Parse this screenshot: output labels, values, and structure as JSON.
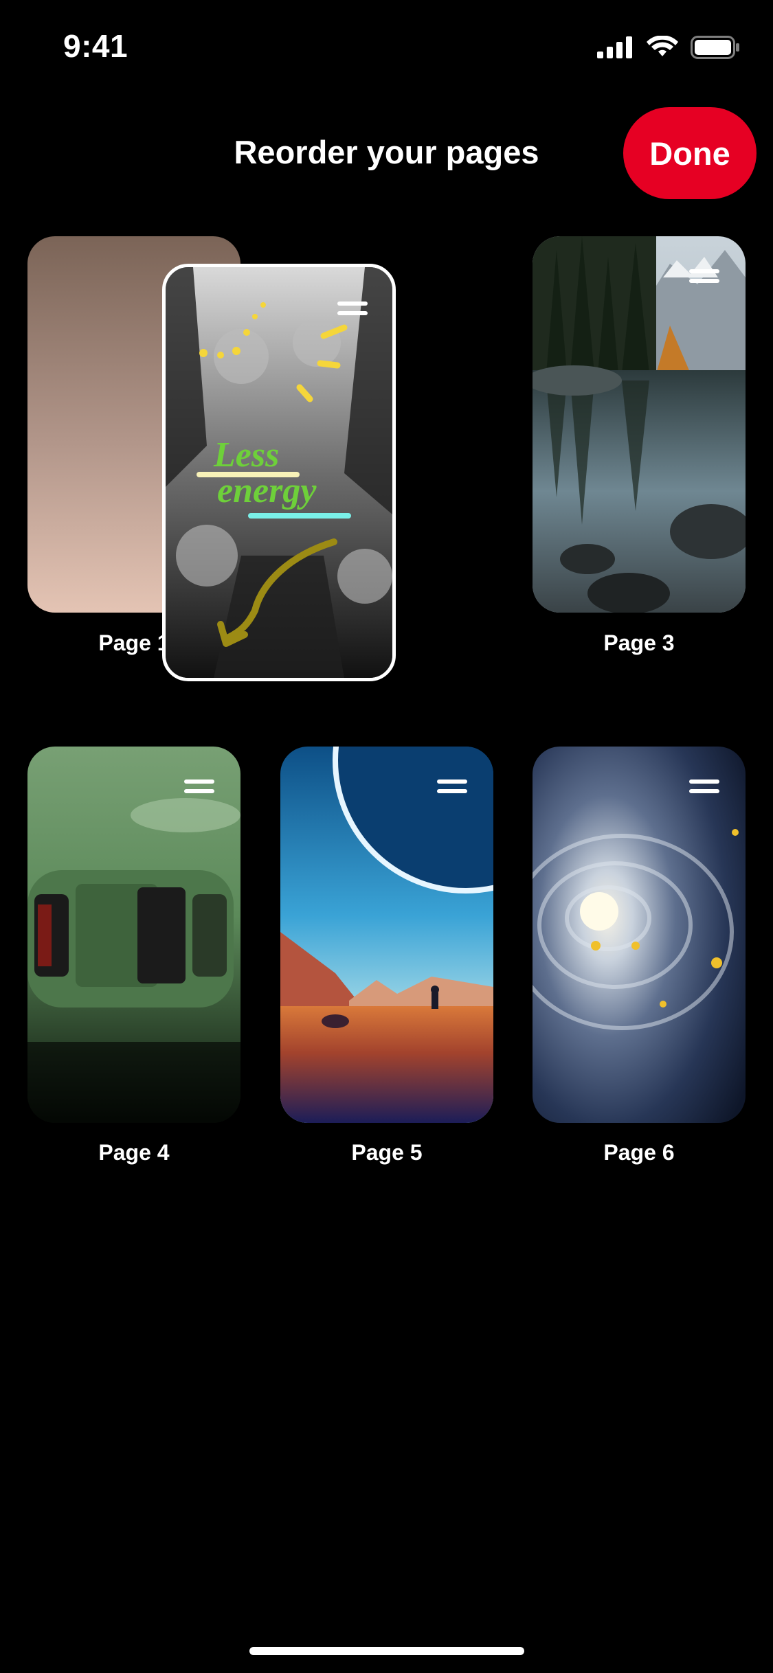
{
  "status_bar": {
    "time": "9:41"
  },
  "header": {
    "title": "Reorder your pages",
    "done_label": "Done"
  },
  "dragging_card": {
    "text_line1": "Less",
    "text_line2": "energy"
  },
  "pages": [
    {
      "label": "Page 1"
    },
    {
      "label": "Page 3"
    },
    {
      "label": "Page 4"
    },
    {
      "label": "Page 5"
    },
    {
      "label": "Page 6"
    }
  ],
  "colors": {
    "accent": "#e60023",
    "background": "#000000"
  }
}
